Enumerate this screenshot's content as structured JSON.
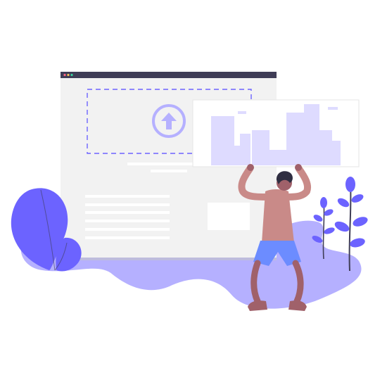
{
  "illustration": {
    "subject": "upload-illustration",
    "colors": {
      "accent": "#6c63ff",
      "accent_dark": "#575a89",
      "accent_light": "#b5b0ff",
      "ground": "#b5b0ff",
      "browser_frame": "#3f3d56",
      "browser_body": "#f2f2f2",
      "panel": "#ffffff",
      "text_line": "#ffffff",
      "skin": "#a0616a",
      "hair": "#2f2e41",
      "shirt": "#c98a88",
      "shorts": "#6c8cff",
      "shoe": "#a0616a",
      "city": "#dedbff",
      "dots": [
        "#ff6584",
        "#f5c35a",
        "#38d39f"
      ]
    },
    "icons": [
      "upload-arrow-icon",
      "window-dots-icon",
      "leaf-plant-icon"
    ]
  }
}
